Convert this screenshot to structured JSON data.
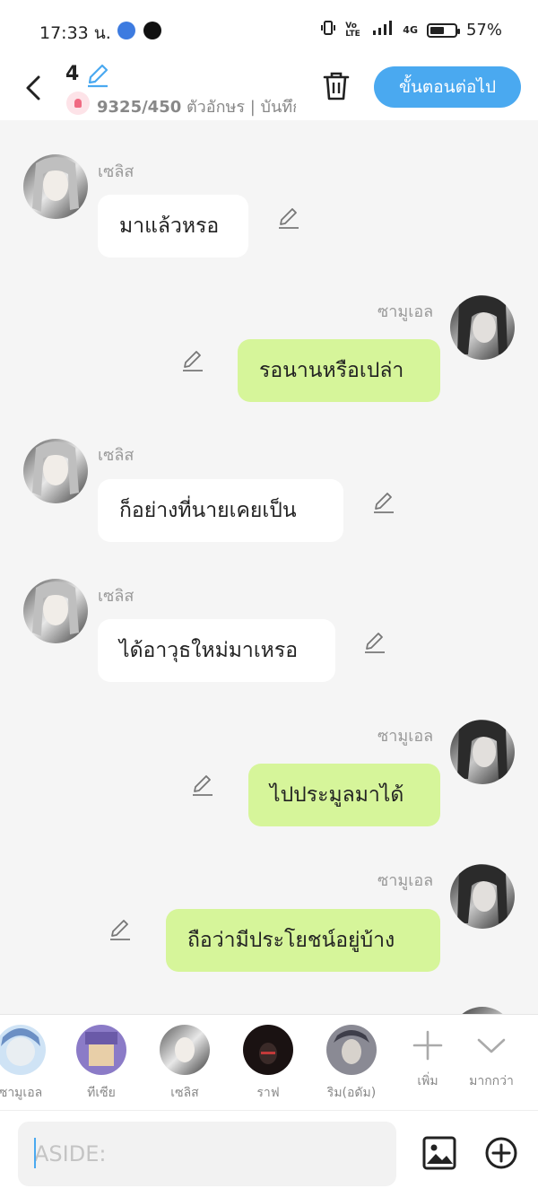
{
  "status": {
    "time": "17:33 น.",
    "battery": "57%",
    "battery_fraction": 0.57,
    "network": "4G",
    "volte": "Vo LTE"
  },
  "header": {
    "chapter": "4",
    "char_count_value": "9325/450",
    "char_count_suffix": " ตัวอักษร | บันทึก",
    "next_label": "ขั้นตอนต่อไป"
  },
  "messages": [
    {
      "side": "left",
      "name": "เซลิส",
      "text": "มาแล้วหรอ"
    },
    {
      "side": "right",
      "name": "ซามูเอล",
      "text": "รอนานหรือเปล่า"
    },
    {
      "side": "left",
      "name": "เซลิส",
      "text": "ก็อย่างที่นายเคยเป็น"
    },
    {
      "side": "left",
      "name": "เซลิส",
      "text": "ได้อาวุธใหม่มาเหรอ"
    },
    {
      "side": "right",
      "name": "ซามูเอล",
      "text": "ไปประมูลมาได้"
    },
    {
      "side": "right",
      "name": "ซามูเอล",
      "text": "ถือว่ามีประโยชน์อยู่บ้าง"
    }
  ],
  "characters": [
    {
      "label": "ซามูเอล"
    },
    {
      "label": "ทีเซีย"
    },
    {
      "label": "เซลิส"
    },
    {
      "label": "ราฟ"
    },
    {
      "label": "ริม(อดัม)"
    }
  ],
  "char_actions": {
    "add_label": "เพิ่ม",
    "more_label": "มากกว่า"
  },
  "input": {
    "placeholder": "ASIDE:"
  },
  "colors": {
    "accent": "#4aa9f0",
    "bubble_right": "#d6f59a",
    "bubble_left": "#ffffff",
    "background": "#f5f5f5"
  }
}
